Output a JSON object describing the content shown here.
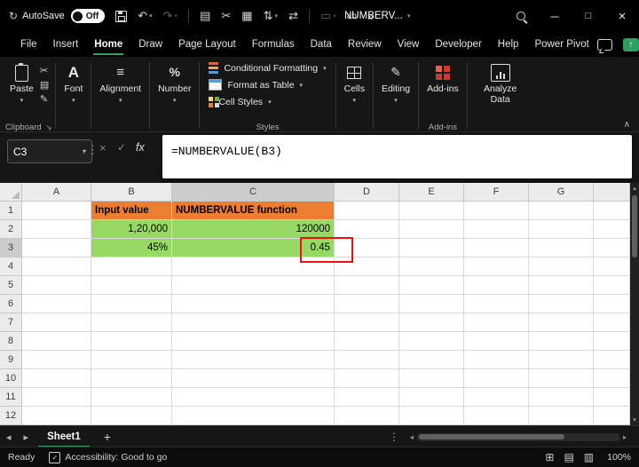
{
  "colors": {
    "accent_green": "#2DA160",
    "fill_orange": "#ED7D31",
    "fill_green": "#97D964",
    "annotation_red": "#EE1111"
  },
  "titlebar": {
    "autosave_label": "AutoSave",
    "autosave_state": "Off",
    "doc_title": "NUMBERV...",
    "window": {
      "minimize": "─",
      "maximize": "□",
      "close": "×"
    }
  },
  "icons": {
    "autosave": "↻",
    "undo": "↶",
    "redo": "↷",
    "dropdown": "▾",
    "copy": "▤",
    "cut": "✂",
    "picture": "▦",
    "sort": "⇅",
    "swap": "⇄",
    "doc": "▭",
    "font_small": "ab",
    "overflow": "»",
    "grip": "⋮",
    "cancel": "×",
    "enter": "✓",
    "fx": "fx",
    "align": "≡",
    "number": "%",
    "font_big": "A",
    "editing": "✎",
    "collapse": "∧",
    "launcher": "↘",
    "nav_left": "◂",
    "nav_right": "▸",
    "up": "▴",
    "down": "▾",
    "plus": "+",
    "share_arrow": "↑",
    "view_normal": "⊞",
    "view_layout": "▤",
    "view_break": "▥",
    "access_check": "✓"
  },
  "menu": {
    "tabs": [
      "File",
      "Insert",
      "Home",
      "Draw",
      "Page Layout",
      "Formulas",
      "Data",
      "Review",
      "View",
      "Developer",
      "Help",
      "Power Pivot"
    ],
    "active_tab": "Home"
  },
  "ribbon": {
    "paste": "Paste",
    "clipboard_group": "Clipboard",
    "font": "Font",
    "alignment": "Alignment",
    "number": "Number",
    "conditional_formatting": "Conditional Formatting",
    "format_as_table": "Format as Table",
    "cell_styles": "Cell Styles",
    "styles_group": "Styles",
    "cells": "Cells",
    "editing": "Editing",
    "addins": "Add-ins",
    "addins_group": "Add-ins",
    "analyze_data": "Analyze Data"
  },
  "formula_bar": {
    "name_box": "C3",
    "formula": "=NUMBERVALUE(B3)"
  },
  "grid": {
    "columns": [
      "A",
      "B",
      "C",
      "D",
      "E",
      "F",
      "G",
      ""
    ],
    "rows": [
      "1",
      "2",
      "3",
      "4",
      "5",
      "6",
      "7",
      "8",
      "9",
      "10",
      "11",
      "12"
    ],
    "selection": {
      "col": "C",
      "row": "3"
    },
    "cells": [
      {
        "ref": "B1",
        "text": "Input value",
        "fill": "orange",
        "bold": true,
        "align": "left"
      },
      {
        "ref": "C1",
        "text": "NUMBERVALUE function",
        "fill": "orange",
        "bold": true,
        "align": "left"
      },
      {
        "ref": "B2",
        "text": "1,20,000",
        "fill": "green",
        "align": "right"
      },
      {
        "ref": "C2",
        "text": "120000",
        "fill": "green",
        "align": "right"
      },
      {
        "ref": "B3",
        "text": "45%",
        "fill": "green",
        "align": "right"
      },
      {
        "ref": "C3",
        "text": "0.45",
        "fill": "green",
        "align": "right"
      }
    ]
  },
  "sheet_bar": {
    "tabs": [
      {
        "label": "Sheet1",
        "active": true
      }
    ]
  },
  "status_bar": {
    "mode": "Ready",
    "accessibility": "Accessibility: Good to go",
    "zoom": "100%"
  }
}
